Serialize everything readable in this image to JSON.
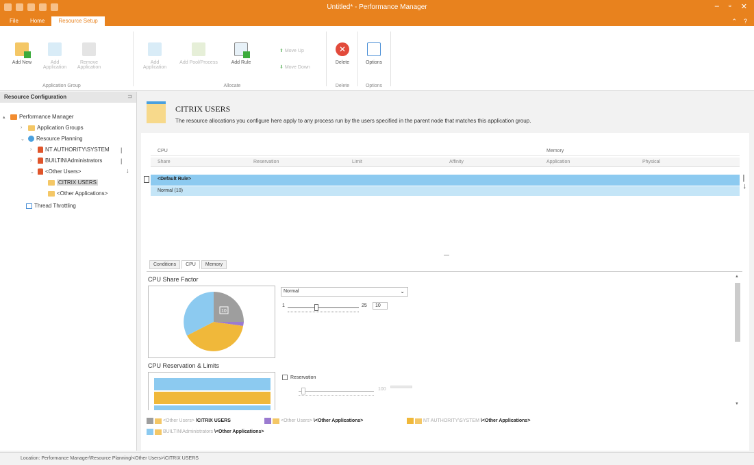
{
  "window": {
    "title": "Untitled* - Performance Manager",
    "controls": [
      "–",
      "▫",
      "✕"
    ],
    "help": [
      "⌃",
      "?"
    ]
  },
  "tabs": [
    "File",
    "Home",
    "Resource Setup"
  ],
  "ribbon": {
    "application_group": {
      "label": "Application Group",
      "buttons": [
        "Add New",
        "Add Application",
        "Remove Application"
      ]
    },
    "allocate": {
      "label": "Allocate",
      "buttons": [
        "Add Application",
        "Add Pool/Process",
        "Add Rule"
      ],
      "move_up": "Move Up",
      "move_down": "Move Down"
    },
    "delete": {
      "label": "Delete",
      "button": "Delete"
    },
    "options": {
      "label": "Options",
      "button": "Options"
    }
  },
  "left_panel": {
    "title": "Resource Configuration",
    "tree": [
      "Performance Manager",
      "Application Groups",
      "Resource Planning",
      "NT AUTHORITY\\SYSTEM",
      "BUILTIN\\Administrators",
      "<Other Users>",
      "CITRIX USERS",
      "<Other Applications>",
      "Thread Throttling"
    ]
  },
  "main": {
    "title": "CITRIX USERS",
    "description": "The resource allocations you configure here apply to any process run by the users specified in the parent node that matches this application group.",
    "grid": {
      "group_headers": [
        "CPU",
        "Memory"
      ],
      "columns": [
        "Share",
        "Reservation",
        "Limit",
        "Affinity",
        "Application",
        "Physical"
      ],
      "rows": [
        "<Default Rule>",
        "Normal (10)"
      ]
    },
    "sub_tabs": [
      "Conditions",
      "CPU",
      "Memory"
    ],
    "cpu_share": {
      "title": "CPU Share Factor",
      "select_value": "Normal",
      "slider_min": "1",
      "slider_max": "25",
      "value": "10",
      "slider_fraction": 0.375,
      "pie_label": "10"
    },
    "cpu_reservation": {
      "title": "CPU Reservation & Limits",
      "checkbox_label": "Reservation",
      "slider_value": "100"
    },
    "legend": [
      {
        "prefix": "<Other Users>",
        "suffix": "\\CITRIX USERS",
        "color": "#9e9e9e"
      },
      {
        "prefix": "<Other Users>",
        "suffix": "\\<Other Applications>",
        "color": "#9b7bd0"
      },
      {
        "prefix": "NT AUTHORITY\\SYSTEM",
        "suffix": "\\<Other Applications>",
        "color": "#f0b83a"
      },
      {
        "prefix": "BUILTIN\\Administrators",
        "suffix": "\\<Other Applications>",
        "color": "#8ccaf0"
      }
    ]
  },
  "status": "Location: Performance Manager\\Resource Planning\\<Other Users>\\CITRIX USERS"
}
